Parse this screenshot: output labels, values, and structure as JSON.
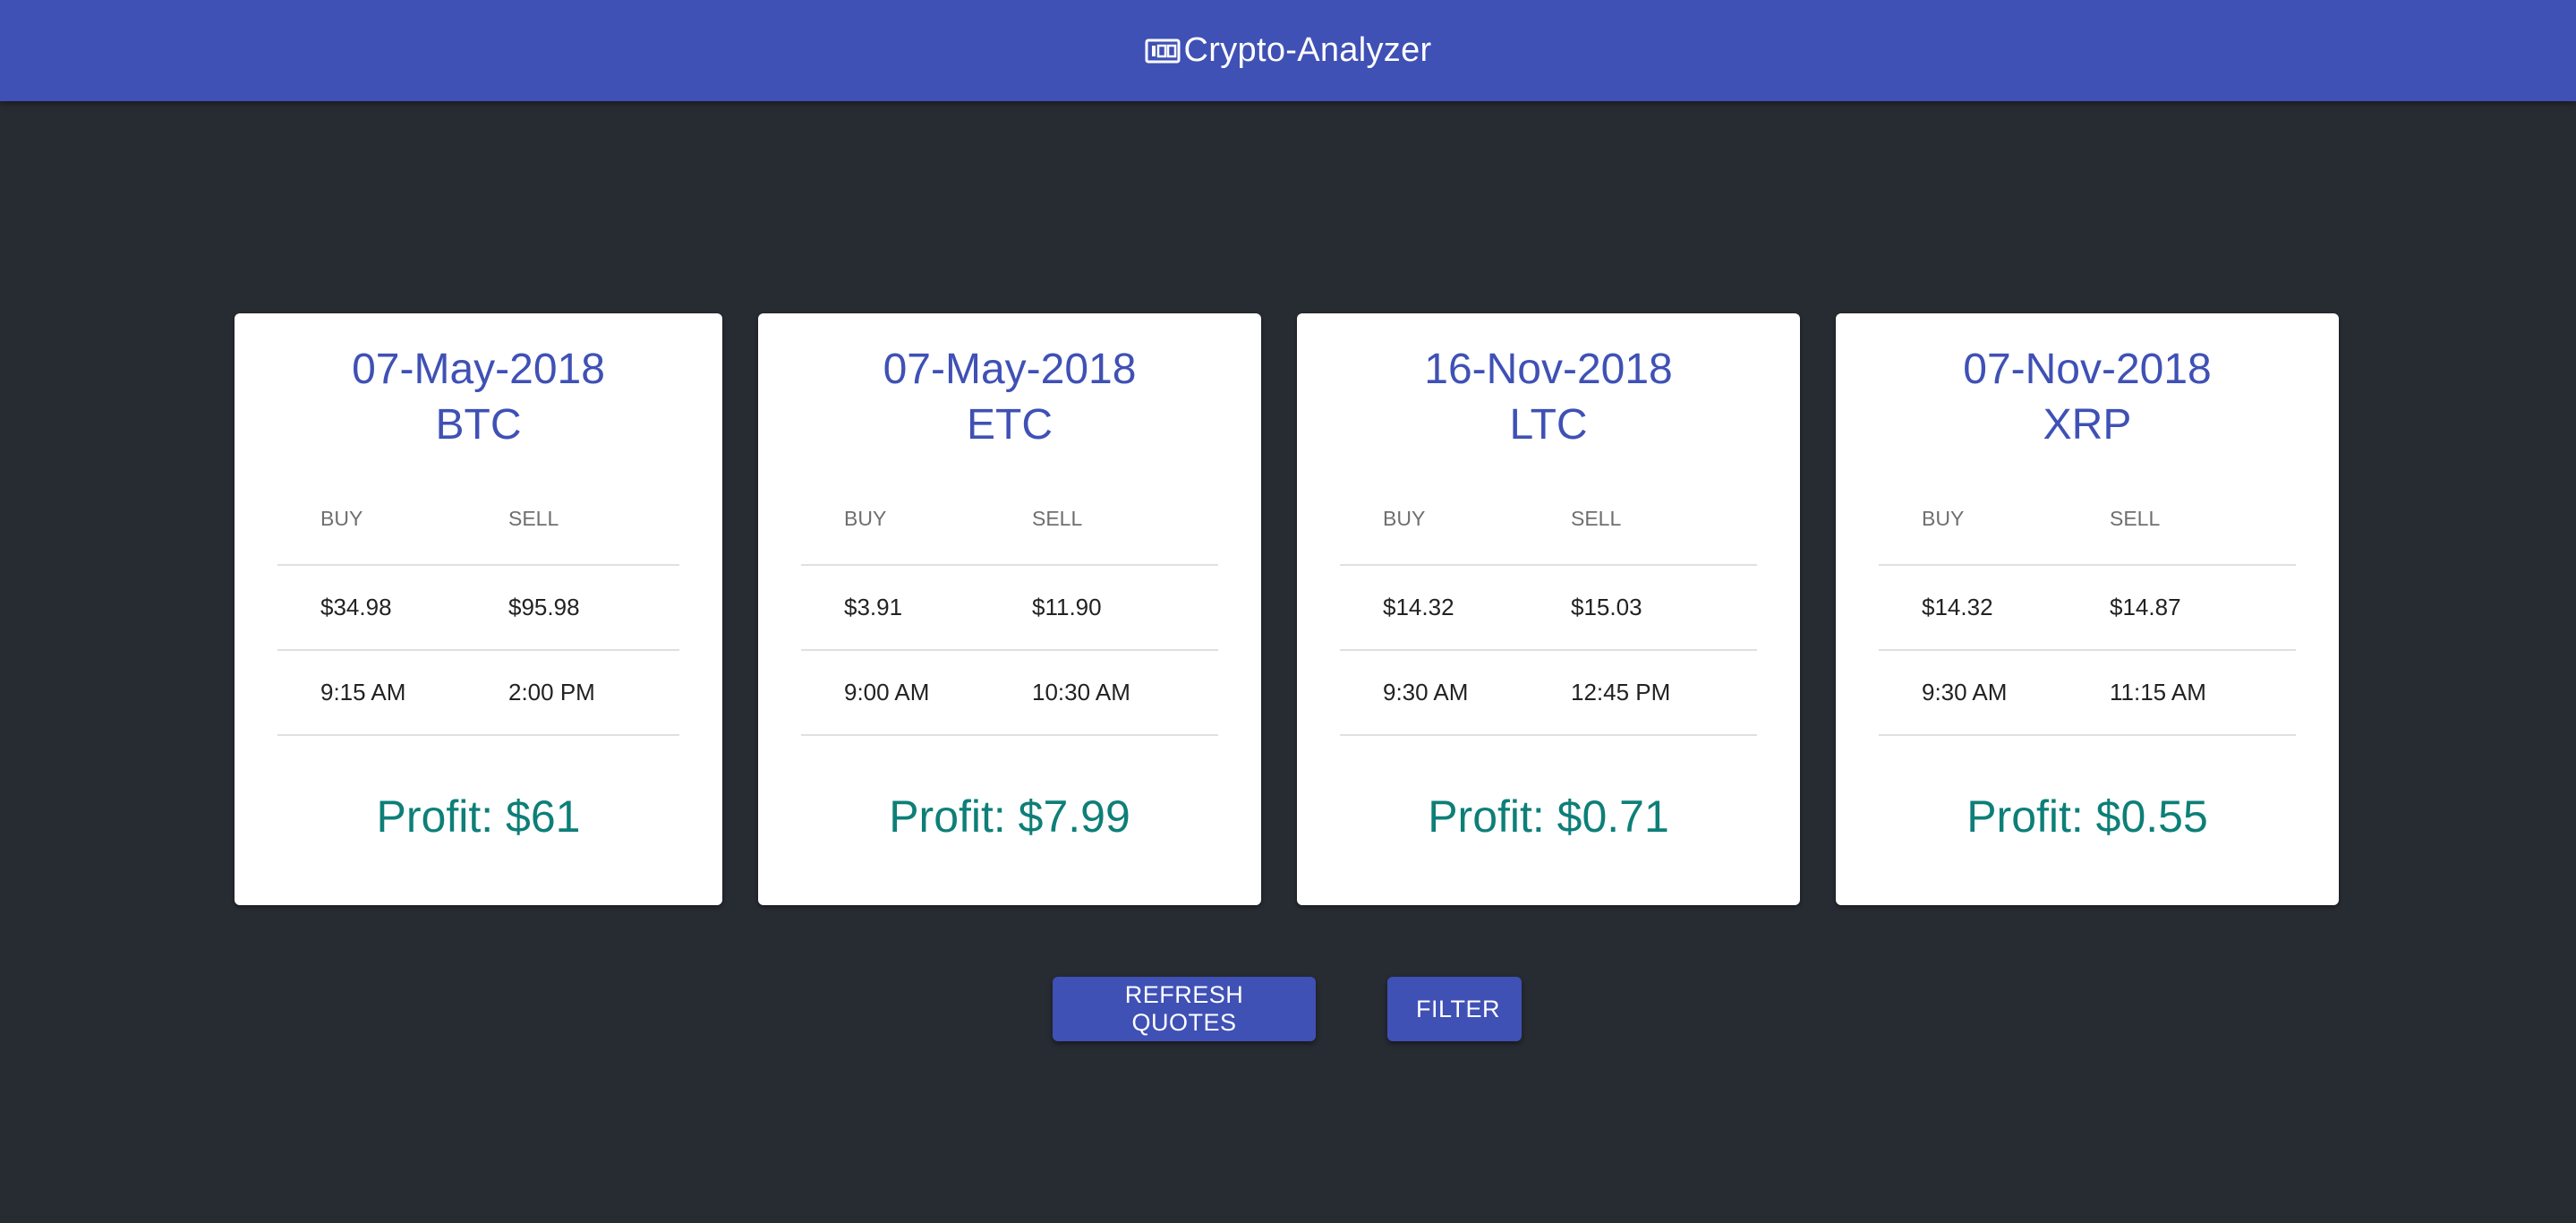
{
  "app": {
    "title": "Crypto-Analyzer",
    "icon": "calculator-icon"
  },
  "colors": {
    "toolbar": "#3f51b5",
    "background": "#272b32",
    "card": "#ffffff",
    "accent": "#3f51b5",
    "profit": "#0d7f78"
  },
  "table_headers": {
    "buy": "BUY",
    "sell": "SELL"
  },
  "cards": [
    {
      "date": "07-May-2018",
      "coin": "BTC",
      "buy_price": "$34.98",
      "sell_price": "$95.98",
      "buy_time": "9:15 AM",
      "sell_time": "2:00 PM",
      "profit": "Profit: $61"
    },
    {
      "date": "07-May-2018",
      "coin": "ETC",
      "buy_price": "$3.91",
      "sell_price": "$11.90",
      "buy_time": "9:00 AM",
      "sell_time": "10:30 AM",
      "profit": "Profit: $7.99"
    },
    {
      "date": "16-Nov-2018",
      "coin": "LTC",
      "buy_price": "$14.32",
      "sell_price": "$15.03",
      "buy_time": "9:30 AM",
      "sell_time": "12:45 PM",
      "profit": "Profit: $0.71"
    },
    {
      "date": "07-Nov-2018",
      "coin": "XRP",
      "buy_price": "$14.32",
      "sell_price": "$14.87",
      "buy_time": "9:30 AM",
      "sell_time": "11:15 AM",
      "profit": "Profit: $0.55"
    }
  ],
  "actions": {
    "refresh_label": "REFRESH QUOTES",
    "filter_label": "FILTER"
  }
}
